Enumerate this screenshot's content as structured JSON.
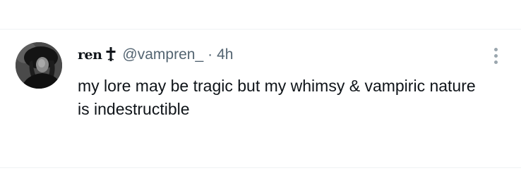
{
  "tweet": {
    "display_name": "ren",
    "name_icon": "latin-cross-icon",
    "handle": "@vampren_",
    "separator": "·",
    "time": "4h",
    "text": "my lore may be tragic but my whimsy & vampiric nature is indestructible",
    "more_icon": "vertical-ellipsis-icon"
  },
  "colors": {
    "text_primary": "#0f1419",
    "text_secondary": "#536471",
    "divider": "#eff3f4",
    "background": "#ffffff"
  }
}
